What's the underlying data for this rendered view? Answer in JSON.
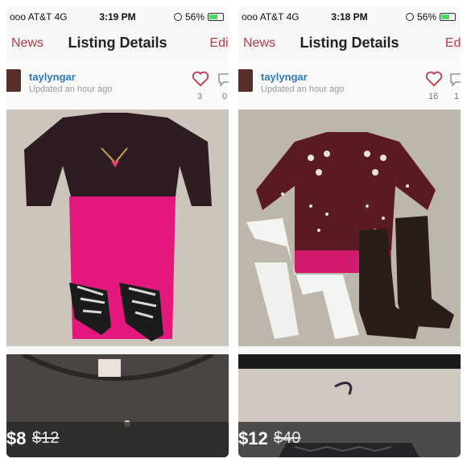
{
  "screens": [
    {
      "status": {
        "carrier": "ooo AT&T  4G",
        "time": "3:19 PM",
        "battery": "56%"
      },
      "nav": {
        "back": "News",
        "title": "Listing Details",
        "edit": "Edit"
      },
      "seller": {
        "username": "taylyngar",
        "updated": "Updated an hour ago"
      },
      "stats": {
        "likes": "3",
        "comments": "0"
      },
      "price": {
        "current": "$8",
        "original": "$12"
      }
    },
    {
      "status": {
        "carrier": "ooo AT&T  4G",
        "time": "3:18 PM",
        "battery": "56%"
      },
      "nav": {
        "back": "News",
        "title": "Listing Details",
        "edit": "Edi"
      },
      "seller": {
        "username": "taylyngar",
        "updated": "Updated an hour ago"
      },
      "stats": {
        "likes": "16",
        "comments": "1"
      },
      "price": {
        "current": "$12",
        "original": "$40"
      }
    }
  ],
  "colors": {
    "accent": "#b23b44",
    "link": "#2a7bbd",
    "battery": "#4bd964"
  },
  "icons": [
    "heart-icon",
    "comment-icon",
    "alarm-lock-icon",
    "battery-icon"
  ]
}
